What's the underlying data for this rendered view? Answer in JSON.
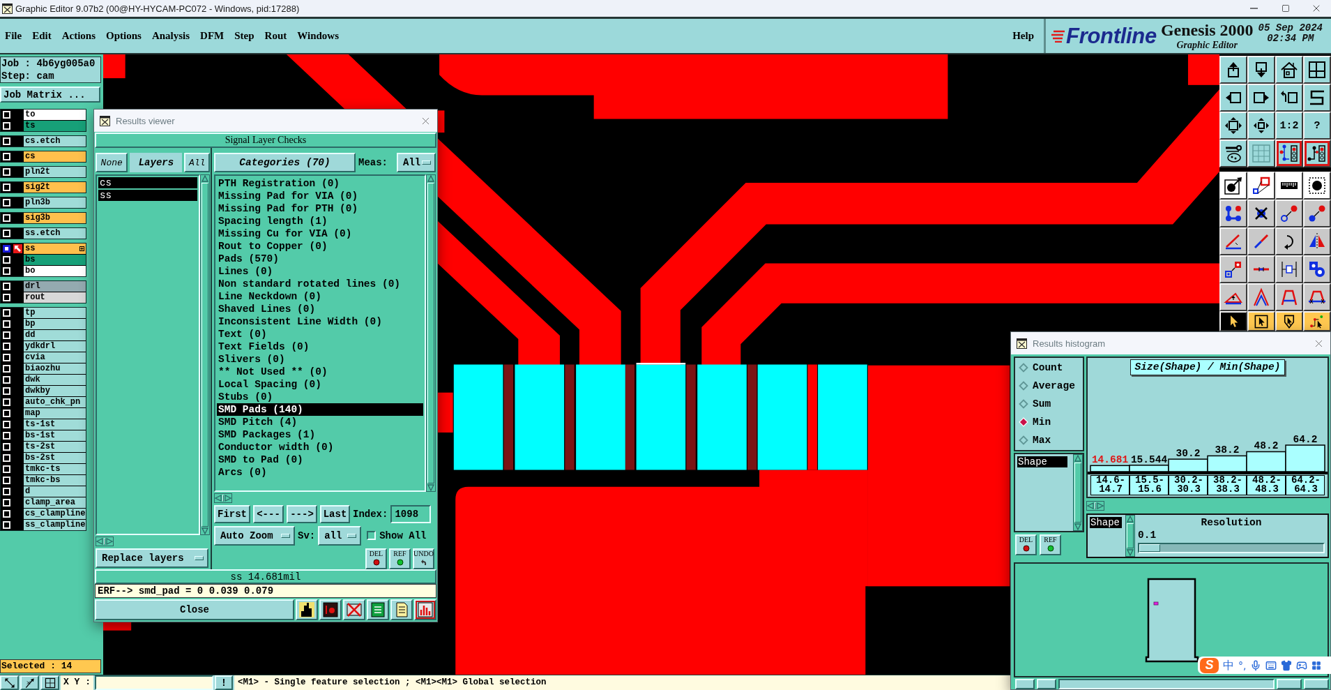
{
  "window": {
    "title": "Graphic Editor 9.07b2 (00@HY-HYCAM-PC072 - Windows, pid:17288)"
  },
  "menu": {
    "items": [
      "File",
      "Edit",
      "Actions",
      "Options",
      "Analysis",
      "DFM",
      "Step",
      "Rout",
      "Windows"
    ],
    "help": "Help"
  },
  "branding": {
    "logo": "Frontline",
    "product": "Genesis 2000",
    "subtitle": "Graphic Editor",
    "date": "05 Sep 2024",
    "time": "02:34 PM"
  },
  "job_panel": {
    "job": "Job : 4b6yg005a0",
    "step": "Step: cam",
    "matrix_button": "Job Matrix ...",
    "layer_groups": [
      {
        "layers": [
          {
            "name": "to",
            "color": "#ffffff",
            "affected": false,
            "work_layer": false
          },
          {
            "name": "ts",
            "color": "#17a078",
            "affected": false,
            "work_layer": false
          }
        ]
      },
      {
        "layers": [
          {
            "name": "cs.etch",
            "color": "#a0dcd8",
            "affected": false,
            "work_layer": false
          }
        ]
      },
      {
        "layers": [
          {
            "name": "cs",
            "color": "#ffc04c",
            "affected": false,
            "work_layer": false
          }
        ]
      },
      {
        "layers": [
          {
            "name": "pln2t",
            "color": "#a0dcd8",
            "affected": false,
            "work_layer": false
          }
        ]
      },
      {
        "layers": [
          {
            "name": "sig2t",
            "color": "#ffc04c",
            "affected": false,
            "work_layer": false
          }
        ]
      },
      {
        "layers": [
          {
            "name": "pln3b",
            "color": "#a0dcd8",
            "affected": false,
            "work_layer": false
          }
        ]
      },
      {
        "layers": [
          {
            "name": "sig3b",
            "color": "#ffc04c",
            "affected": false,
            "work_layer": false
          }
        ]
      },
      {
        "layers": [
          {
            "name": "ss.etch",
            "color": "#a0dcd8",
            "affected": false,
            "work_layer": false
          }
        ]
      },
      {
        "layers": [
          {
            "name": "ss",
            "color": "#ffc04c",
            "affected": true,
            "work_layer": true
          },
          {
            "name": "bs",
            "color": "#17a078",
            "affected": false,
            "work_layer": false
          },
          {
            "name": "bo",
            "color": "#ffffff",
            "affected": false,
            "work_layer": false
          }
        ]
      },
      {
        "layers": [
          {
            "name": "drl",
            "color": "#94aab0",
            "affected": false,
            "work_layer": false
          },
          {
            "name": "rout",
            "color": "#d8d8d8",
            "affected": false,
            "work_layer": false
          }
        ]
      },
      {
        "layers": [
          {
            "name": "tp",
            "color": "#a0dcd8",
            "affected": false,
            "work_layer": false
          },
          {
            "name": "bp",
            "color": "#a0dcd8",
            "affected": false,
            "work_layer": false
          },
          {
            "name": "dd",
            "color": "#a0dcd8",
            "affected": false,
            "work_layer": false
          },
          {
            "name": "ydkdrl",
            "color": "#a0dcd8",
            "affected": false,
            "work_layer": false
          },
          {
            "name": "cvia",
            "color": "#a0dcd8",
            "affected": false,
            "work_layer": false
          },
          {
            "name": "biaozhu",
            "color": "#a0dcd8",
            "affected": false,
            "work_layer": false
          },
          {
            "name": "dwk",
            "color": "#a0dcd8",
            "affected": false,
            "work_layer": false
          },
          {
            "name": "dwkby",
            "color": "#a0dcd8",
            "affected": false,
            "work_layer": false
          },
          {
            "name": "auto_chk_pn",
            "color": "#a0dcd8",
            "affected": false,
            "work_layer": false
          },
          {
            "name": "map",
            "color": "#a0dcd8",
            "affected": false,
            "work_layer": false
          },
          {
            "name": "ts-1st",
            "color": "#a0dcd8",
            "affected": false,
            "work_layer": false
          },
          {
            "name": "bs-1st",
            "color": "#a0dcd8",
            "affected": false,
            "work_layer": false
          },
          {
            "name": "ts-2st",
            "color": "#a0dcd8",
            "affected": false,
            "work_layer": false
          },
          {
            "name": "bs-2st",
            "color": "#a0dcd8",
            "affected": false,
            "work_layer": false
          },
          {
            "name": "tmkc-ts",
            "color": "#a0dcd8",
            "affected": false,
            "work_layer": false
          },
          {
            "name": "tmkc-bs",
            "color": "#a0dcd8",
            "affected": false,
            "work_layer": false
          },
          {
            "name": "d",
            "color": "#a0dcd8",
            "affected": false,
            "work_layer": false
          },
          {
            "name": "clamp_area",
            "color": "#a0dcd8",
            "affected": false,
            "work_layer": false
          },
          {
            "name": "cs_clampline",
            "color": "#a0dcd8",
            "affected": false,
            "work_layer": false
          },
          {
            "name": "ss_clampline",
            "color": "#a0dcd8",
            "affected": false,
            "work_layer": false
          }
        ]
      }
    ],
    "selected_count": "Selected : 14"
  },
  "toolbar": {
    "groups": [
      {
        "kind": "view",
        "buttons": [
          {
            "on": false
          },
          {
            "on": false
          },
          {
            "on": false
          },
          {
            "on": false
          },
          {
            "on": false
          },
          {
            "on": false
          },
          {
            "on": false
          },
          {
            "on": false
          },
          {
            "on": false
          },
          {
            "on": false
          },
          {
            "label": "1:2",
            "on": false
          },
          {
            "label": "?",
            "on": false
          },
          {
            "on": false
          },
          {
            "on": false
          },
          {
            "on": true
          },
          {
            "on": true
          }
        ]
      },
      {
        "kind": "feature",
        "buttons": [
          {
            "on": false
          },
          {
            "on": false
          },
          {
            "on": false
          },
          {
            "on": false
          }
        ]
      },
      {
        "kind": "edit",
        "buttons": [
          {
            "on": false
          },
          {
            "on": false
          },
          {
            "on": false
          },
          {
            "on": false
          },
          {
            "on": false
          },
          {
            "on": false
          },
          {
            "on": false
          },
          {
            "on": false
          },
          {
            "on": false
          },
          {
            "on": false
          },
          {
            "on": false
          },
          {
            "on": false
          },
          {
            "on": false
          },
          {
            "on": false
          },
          {
            "on": false
          },
          {
            "on": false
          }
        ]
      },
      {
        "kind": "select",
        "buttons": [
          {
            "on": true
          },
          {
            "on": false
          },
          {
            "on": false
          },
          {
            "on": false
          }
        ]
      }
    ]
  },
  "status_bar": {
    "xy_label": "X Y :",
    "alert": "!",
    "message": "<M1> - Single feature selection ; <M1><M1> Global selection"
  },
  "results_viewer": {
    "title": "Results viewer",
    "heading": "Signal Layer Checks",
    "none_button": "None",
    "layers_label": "Layers",
    "all_button": "All",
    "layers": [
      {
        "name": "cs",
        "selected": true
      },
      {
        "name": "ss",
        "selected": true
      }
    ],
    "replace_mode": "Replace layers",
    "categories_button": "Categories (70)",
    "meas_label": "Meas:",
    "meas_value": "All",
    "categories": [
      {
        "label": "PTH Registration (0)",
        "selected": false
      },
      {
        "label": "Missing Pad for VIA (0)",
        "selected": false
      },
      {
        "label": "Missing Pad for PTH (0)",
        "selected": false
      },
      {
        "label": "Spacing length (1)",
        "selected": false
      },
      {
        "label": "Missing Cu for VIA (0)",
        "selected": false
      },
      {
        "label": "Rout to Copper (0)",
        "selected": false
      },
      {
        "label": "Pads (570)",
        "selected": false
      },
      {
        "label": "Lines (0)",
        "selected": false
      },
      {
        "label": "Non standard rotated lines (0)",
        "selected": false
      },
      {
        "label": "Line Neckdown (0)",
        "selected": false
      },
      {
        "label": "Shaved Lines (0)",
        "selected": false
      },
      {
        "label": "Inconsistent Line Width (0)",
        "selected": false
      },
      {
        "label": "Text (0)",
        "selected": false
      },
      {
        "label": "Text Fields (0)",
        "selected": false
      },
      {
        "label": "Slivers (0)",
        "selected": false
      },
      {
        "label": "** Not Used ** (0)",
        "selected": false
      },
      {
        "label": "Local Spacing (0)",
        "selected": false
      },
      {
        "label": "Stubs (0)",
        "selected": false
      },
      {
        "label": "SMD Pads (140)",
        "selected": true
      },
      {
        "label": "SMD Pitch (4)",
        "selected": false
      },
      {
        "label": "SMD Packages (1)",
        "selected": false
      },
      {
        "label": "Conductor width (0)",
        "selected": false
      },
      {
        "label": "SMD to Pad (0)",
        "selected": false
      },
      {
        "label": "Arcs (0)",
        "selected": false
      }
    ],
    "nav_buttons": [
      "First",
      "<---",
      "--->",
      "Last"
    ],
    "index_label": "Index:",
    "index_value": "1098",
    "zoom_mode": "Auto Zoom",
    "sv_label": "Sv:",
    "sv_value": "all",
    "show_all": {
      "label": "Show All",
      "checked": false
    },
    "actions": [
      "DEL",
      "REF",
      "UNDO"
    ],
    "measurement": "ss 14.681mil",
    "erf": "ERF--> smd_pad = 0 0.039 0.079",
    "close": "Close",
    "tools": [
      {
        "on": false
      },
      {
        "on": false
      },
      {
        "on": false
      },
      {
        "on": false
      },
      {
        "on": false
      },
      {
        "on": true
      }
    ]
  },
  "results_histogram": {
    "title": "Results histogram",
    "modes": [
      {
        "label": "Count",
        "selected": false
      },
      {
        "label": "Average",
        "selected": false
      },
      {
        "label": "Sum",
        "selected": false
      },
      {
        "label": "Min",
        "selected": true
      },
      {
        "label": "Max",
        "selected": false
      }
    ],
    "attributes": [
      {
        "label": "Shape",
        "selected": true
      }
    ],
    "buttons": [
      "DEL",
      "REF"
    ],
    "chart_data": {
      "type": "bar",
      "title": "Size(Shape) / Min(Shape)",
      "categories": [
        "14.6-14.7",
        "15.5-15.6",
        "30.2-30.3",
        "38.2-38.3",
        "48.2-48.3",
        "64.2-64.3"
      ],
      "values": [
        14.681,
        15.544,
        30.2,
        38.2,
        48.2,
        64.2
      ],
      "value_labels": [
        "14.681",
        "15.544",
        "30.2",
        "38.2",
        "48.2",
        "64.2"
      ]
    },
    "bins": [
      {
        "selected": true
      },
      {
        "selected": false
      },
      {
        "selected": false
      },
      {
        "selected": false
      },
      {
        "selected": false
      },
      {
        "selected": false
      }
    ],
    "groups": [
      {
        "label": "Shape",
        "selected": true
      }
    ],
    "resolution": {
      "label": "Resolution",
      "value": "0.1",
      "level": 0
    }
  },
  "ime_bar": {
    "logo": "S",
    "mode": "中",
    "punctuation": "°,"
  }
}
